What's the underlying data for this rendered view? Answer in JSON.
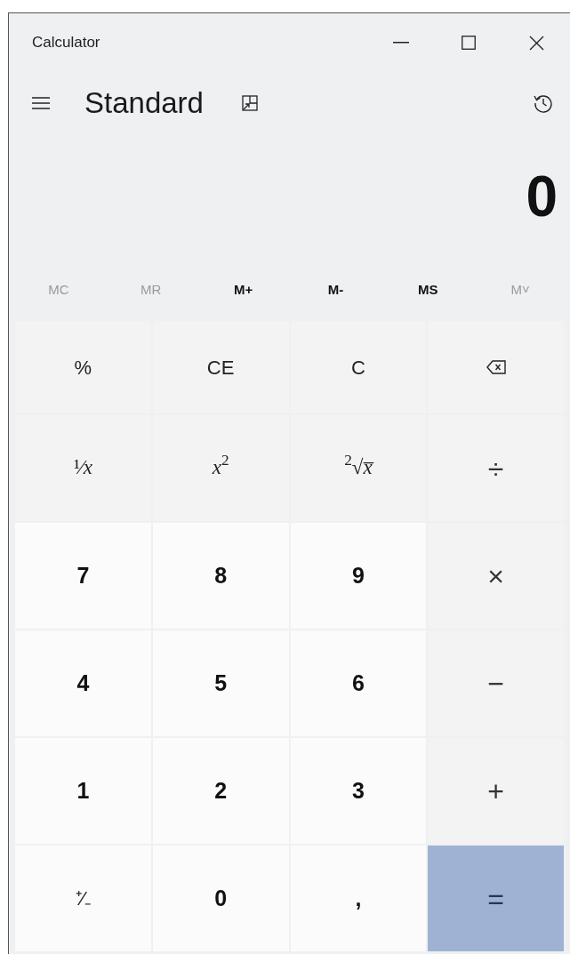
{
  "window": {
    "title": "Calculator"
  },
  "header": {
    "mode": "Standard"
  },
  "display": {
    "value": "0"
  },
  "memory": [
    {
      "label": "MC",
      "disabled": true
    },
    {
      "label": "MR",
      "disabled": true
    },
    {
      "label": "M+",
      "disabled": false
    },
    {
      "label": "M-",
      "disabled": false
    },
    {
      "label": "MS",
      "disabled": false
    },
    {
      "label": "M˅",
      "disabled": true
    }
  ],
  "keys": [
    {
      "label": "%",
      "kind": "function"
    },
    {
      "label": "CE",
      "kind": "function"
    },
    {
      "label": "C",
      "kind": "function"
    },
    {
      "kind": "backspace"
    },
    {
      "label": "¹⁄*x*",
      "kind": "math"
    },
    {
      "label": "*x*$^{2}$",
      "kind": "math"
    },
    {
      "label": "$^{2}$√*x̅*",
      "kind": "math"
    },
    {
      "label": "÷",
      "kind": "operator"
    },
    {
      "label": "7",
      "kind": "digit"
    },
    {
      "label": "8",
      "kind": "digit"
    },
    {
      "label": "9",
      "kind": "digit"
    },
    {
      "label": "×",
      "kind": "operator"
    },
    {
      "label": "4",
      "kind": "digit"
    },
    {
      "label": "5",
      "kind": "digit"
    },
    {
      "label": "6",
      "kind": "digit"
    },
    {
      "label": "−",
      "kind": "operator"
    },
    {
      "label": "1",
      "kind": "digit"
    },
    {
      "label": "2",
      "kind": "digit"
    },
    {
      "label": "3",
      "kind": "digit"
    },
    {
      "label": "+",
      "kind": "operator"
    },
    {
      "label": "⁺⁄₋",
      "kind": "plain"
    },
    {
      "label": "0",
      "kind": "digit"
    },
    {
      "label": ",",
      "kind": "digit"
    },
    {
      "label": "=",
      "kind": "equals"
    }
  ]
}
